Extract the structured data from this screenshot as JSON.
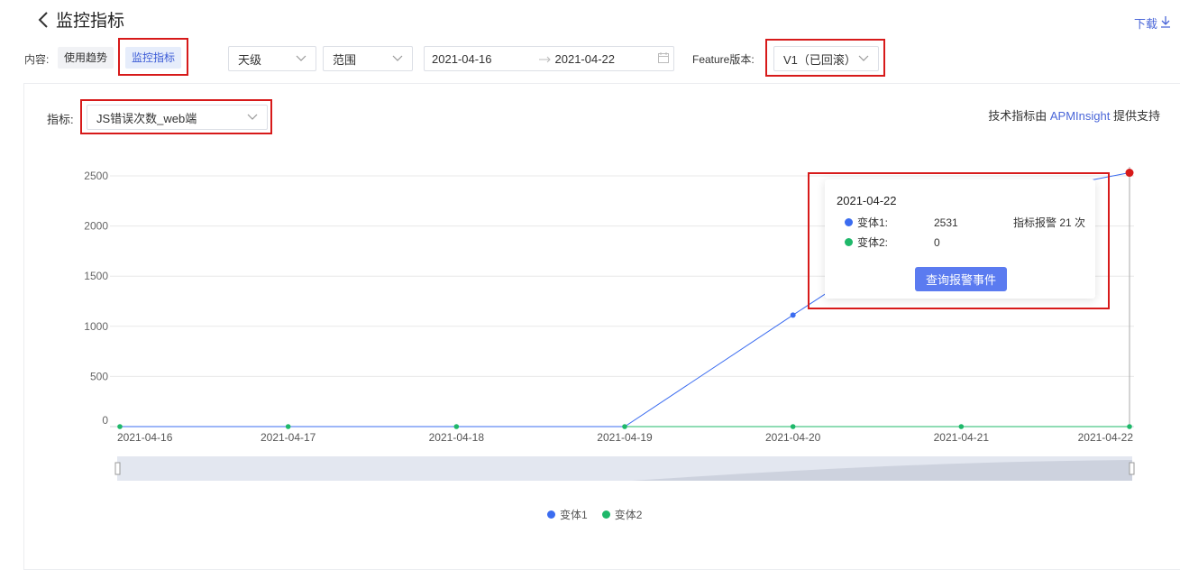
{
  "header": {
    "title": "监控指标",
    "download": "下载"
  },
  "filters": {
    "content_label": "内容:",
    "content_tabs": [
      "使用趋势",
      "监控指标"
    ],
    "granularity": "天级",
    "range_select": "范围",
    "date_start": "2021-04-16",
    "date_end": "2021-04-22",
    "feature_label": "Feature版本:",
    "feature_version": "V1（已回滚）"
  },
  "metric": {
    "label": "指标:",
    "value": "JS错误次数_web端"
  },
  "support": {
    "prefix": "技术指标由 ",
    "brand": "APMInsight",
    "suffix": " 提供支持"
  },
  "tooltip": {
    "date": "2021-04-22",
    "rows": [
      {
        "name": "变体1:",
        "value": "2531",
        "alarm": "指标报警 21 次"
      },
      {
        "name": "变体2:",
        "value": "0"
      }
    ],
    "button": "查询报警事件"
  },
  "colors": {
    "series1": "#3b6cf0",
    "series2": "#1fb86a",
    "highlight": "#d71a1a",
    "accent": "#4a66d8"
  },
  "chart_data": {
    "type": "line",
    "x": [
      "2021-04-16",
      "2021-04-17",
      "2021-04-18",
      "2021-04-19",
      "2021-04-20",
      "2021-04-21",
      "2021-04-22"
    ],
    "series": [
      {
        "name": "变体1",
        "values": [
          0,
          0,
          0,
          0,
          1112,
          2210,
          2531
        ]
      },
      {
        "name": "变体2",
        "values": [
          0,
          0,
          0,
          0,
          0,
          0,
          0
        ]
      }
    ],
    "yticks": [
      0,
      500,
      1000,
      1500,
      2000,
      2500
    ],
    "ylim": [
      0,
      2500
    ],
    "grid": true,
    "legend": "bottom-center"
  }
}
